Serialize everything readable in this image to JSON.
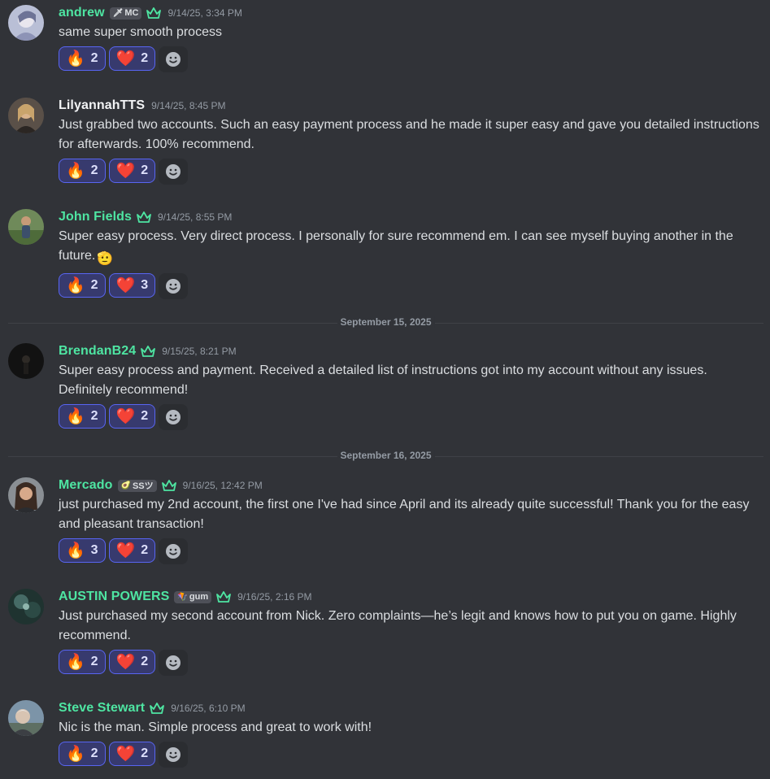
{
  "messages": [
    {
      "username": "andrew",
      "name_color": "green",
      "tag": {
        "icon": "🗡",
        "text": "MC"
      },
      "has_crown": true,
      "timestamp": "9/14/25, 3:34 PM",
      "text": "same super smooth process",
      "fire": "2",
      "heart": "2"
    },
    {
      "username": "LilyannahTTS",
      "name_color": "white",
      "has_crown": false,
      "timestamp": "9/14/25, 8:45 PM",
      "text": "Just grabbed two accounts. Such an easy payment process and he made it super easy and gave you detailed instructions for afterwards. 100% recommend.",
      "fire": "2",
      "heart": "2"
    },
    {
      "username": "John Fields",
      "name_color": "green",
      "has_crown": true,
      "timestamp": "9/14/25, 8:55 PM",
      "text": "Super easy process. Very direct process. I personally for sure recommend em. I can see myself buying another in the future.",
      "inline_emoji": "🫡",
      "fire": "2",
      "heart": "3"
    },
    {
      "username": "BrendanB24",
      "name_color": "green",
      "has_crown": true,
      "timestamp": "9/15/25, 8:21 PM",
      "text": "Super easy process and payment. Received a detailed list of instructions got into my account without any issues. Definitely recommend!",
      "fire": "2",
      "heart": "2"
    },
    {
      "username": "Mercado",
      "name_color": "green",
      "tag": {
        "icon": "🥑",
        "text": "SSツ"
      },
      "has_crown": true,
      "timestamp": "9/16/25, 12:42 PM",
      "text": "just purchased my 2nd account, the first one I've had since April and its already quite successful!  Thank you for the easy and pleasant transaction!",
      "fire": "3",
      "heart": "2"
    },
    {
      "username": "AUSTIN POWERS",
      "name_color": "green",
      "tag": {
        "icon": "🪁",
        "text": "gum"
      },
      "has_crown": true,
      "timestamp": "9/16/25, 2:16 PM",
      "text": "Just purchased my second account from Nick. Zero complaints—he’s legit and knows how to put you on game. Highly recommend.",
      "fire": "2",
      "heart": "2"
    },
    {
      "username": "Steve Stewart",
      "name_color": "green",
      "has_crown": true,
      "timestamp": "9/16/25, 6:10 PM",
      "text": "Nic is the man. Simple process and great to work with!",
      "fire": "2",
      "heart": "2"
    }
  ],
  "dividers": [
    "September 15, 2025",
    "September 16, 2025"
  ],
  "reaction_emojis": {
    "fire": "🔥",
    "heart": "❤️"
  },
  "colors": {
    "background": "#313338",
    "name_green": "#4ee5a2",
    "reaction_bg": "#373a6e",
    "reaction_border": "#5865f2",
    "timestamp": "#949ba4"
  }
}
